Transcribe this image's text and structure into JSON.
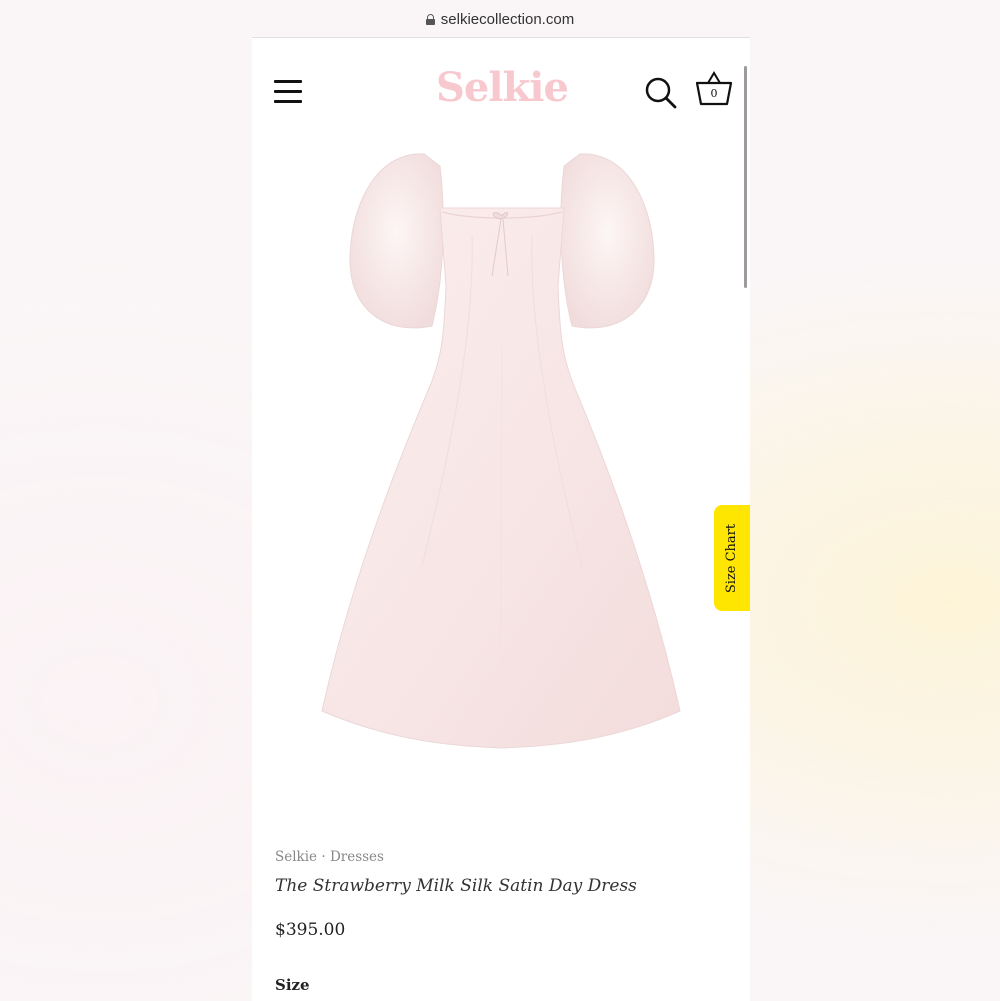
{
  "browser": {
    "url": "selkiecollection.com",
    "lock_icon": "lock-icon"
  },
  "header": {
    "menu_icon": "hamburger-menu-icon",
    "logo": "Selkie",
    "search_icon": "search-icon",
    "cart_icon": "basket-icon",
    "cart_count": "0"
  },
  "side_tab": {
    "label": "Size Chart"
  },
  "product": {
    "breadcrumb": {
      "brand": "Selkie",
      "separator": "·",
      "category": "Dresses"
    },
    "title": "The Strawberry Milk Silk Satin Day Dress",
    "price": "$395.00",
    "size_label": "Size",
    "size_value": ""
  },
  "colors": {
    "logo_pink": "#f7c9cf",
    "size_tab_yellow": "#ffe600",
    "dress_pink": "#f7e8e8"
  }
}
